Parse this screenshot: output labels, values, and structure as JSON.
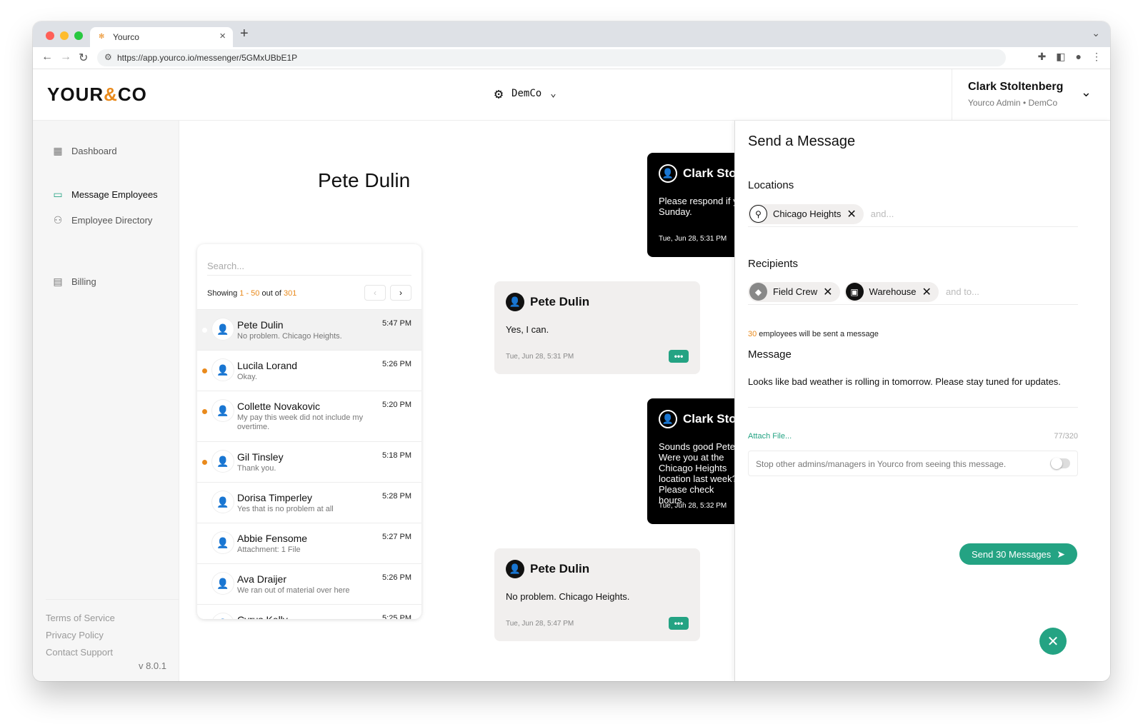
{
  "browser": {
    "tab_title": "Yourco",
    "url": "https://app.yourco.io/messenger/5GMxUBbE1P"
  },
  "header": {
    "logo_left": "YOUR",
    "logo_amp": "&",
    "logo_right": "CO",
    "company": "DemCo",
    "user_name": "Clark Stoltenberg",
    "user_role": "Yourco Admin • DemCo"
  },
  "sidebar": {
    "items": [
      {
        "label": "Dashboard",
        "icon": "dashboard-icon",
        "active": false
      },
      {
        "label": "Message Employees",
        "icon": "messages-icon",
        "active": true
      },
      {
        "label": "Employee Directory",
        "icon": "people-icon",
        "active": false
      },
      {
        "label": "Billing",
        "icon": "billing-icon",
        "active": false
      }
    ],
    "footer": {
      "terms": "Terms of Service",
      "privacy": "Privacy Policy",
      "support": "Contact Support",
      "version": "v 8.0.1"
    }
  },
  "conversation": {
    "title": "Pete Dulin"
  },
  "list": {
    "search_placeholder": "Search...",
    "showing_prefix": "Showing ",
    "showing_range": "1 - 50",
    "showing_mid": " out of ",
    "showing_total": "301",
    "rows": [
      {
        "name": "Pete Dulin",
        "preview": "No problem. Chicago Heights.",
        "time": "5:47 PM",
        "unread": false,
        "selected": true
      },
      {
        "name": "Lucila Lorand",
        "preview": "Okay.",
        "time": "5:26 PM",
        "unread": true,
        "selected": false
      },
      {
        "name": "Collette Novakovic",
        "preview": "My pay this week did not include my overtime.",
        "time": "5:20 PM",
        "unread": true,
        "selected": false
      },
      {
        "name": "Gil Tinsley",
        "preview": "Thank you.",
        "time": "5:18 PM",
        "unread": true,
        "selected": false
      },
      {
        "name": "Dorisa Timperley",
        "preview": "Yes that is no problem at all",
        "time": "5:28 PM",
        "unread": false,
        "selected": false
      },
      {
        "name": "Abbie Fensome",
        "preview": "Attachment: 1 File",
        "time": "5:27 PM",
        "unread": false,
        "selected": false
      },
      {
        "name": "Ava Draijer",
        "preview": "We ran out of material over here",
        "time": "5:26 PM",
        "unread": false,
        "selected": false
      },
      {
        "name": "Cyrus Kelly",
        "preview": "",
        "time": "5:25 PM",
        "unread": false,
        "selected": false
      }
    ]
  },
  "messages": [
    {
      "from": "Clark Stoltenberg",
      "direction": "out",
      "text": "Please respond if you can work overtime next Sunday.",
      "time": "Tue, Jun 28, 5:31 PM"
    },
    {
      "from": "Pete Dulin",
      "direction": "in",
      "text": "Yes, I can.",
      "time": "Tue, Jun 28, 5:31 PM"
    },
    {
      "from": "Clark Stoltenberg",
      "direction": "out",
      "text": "Sounds good Pete. Were you at the Chicago Heights location last week? Please check hours.",
      "time": "Tue, Jun 28, 5:32 PM"
    },
    {
      "from": "Pete Dulin",
      "direction": "in",
      "text": "No problem. Chicago Heights.",
      "time": "Tue, Jun 28, 5:47 PM"
    }
  ],
  "panel": {
    "title": "Send a Message",
    "locations_label": "Locations",
    "locations": [
      {
        "label": "Chicago Heights",
        "icon": "location-pin-icon"
      }
    ],
    "locations_more": "and...",
    "recipients_label": "Recipients",
    "recipients": [
      {
        "label": "Field Crew",
        "icon": "tag-icon"
      },
      {
        "label": "Warehouse",
        "icon": "briefcase-icon"
      }
    ],
    "recipients_more": "and to...",
    "count_value": "30",
    "count_suffix": " employees will be sent a message",
    "message_label": "Message",
    "message_text": "Looks like bad weather is rolling in tomorrow. Please stay tuned for updates.",
    "attach_label": "Attach File...",
    "char_count": "77/320",
    "privacy_text": "Stop other admins/managers in Yourco from seeing this message.",
    "privacy_on": false,
    "send_label": "Send 30 Messages"
  },
  "colors": {
    "accent": "#24a383",
    "highlight": "#e98a1c"
  }
}
